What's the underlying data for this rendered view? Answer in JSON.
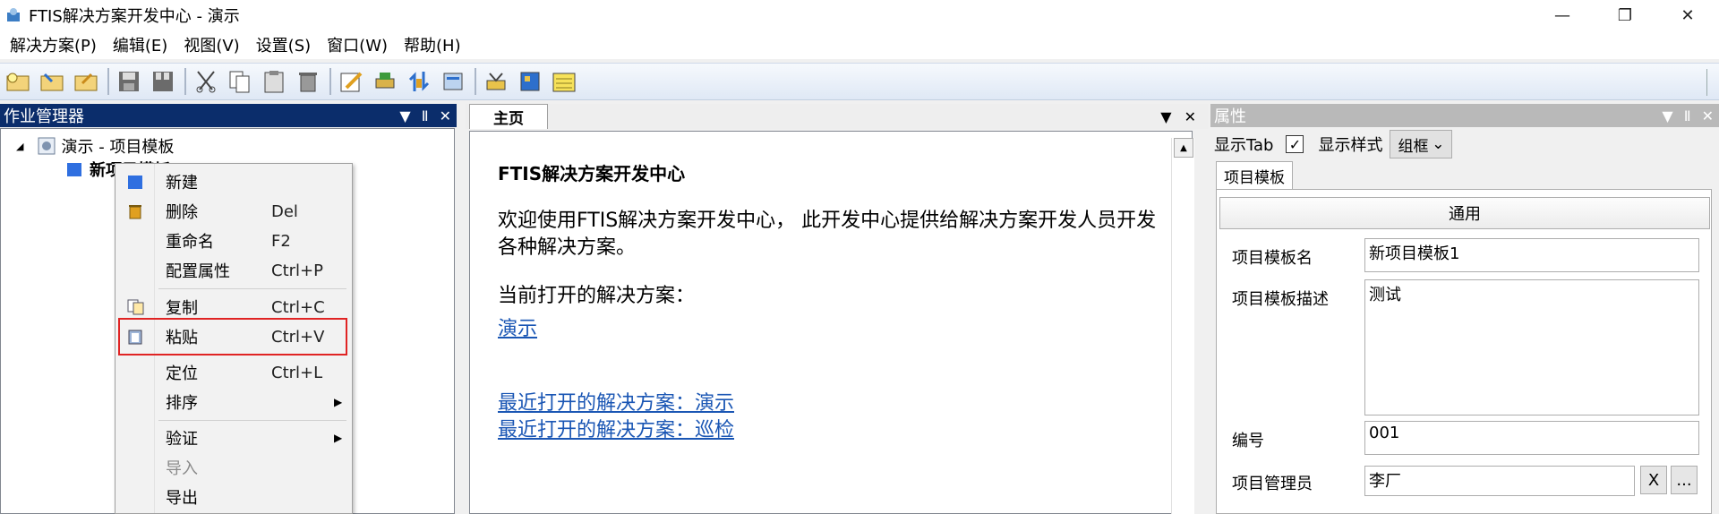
{
  "window": {
    "title": "FTIS解决方案开发中心 - 演示",
    "minimize": "—",
    "restore": "❐",
    "close": "✕"
  },
  "menu": [
    "解决方案(P)",
    "编辑(E)",
    "视图(V)",
    "设置(S)",
    "窗口(W)",
    "帮助(H)"
  ],
  "toolbar_icons": [
    "new-solution-icon",
    "open-solution-icon",
    "edit-solution-icon",
    "save-icon",
    "save-all-icon",
    "cut-icon",
    "copy-icon",
    "paste-icon",
    "delete-icon",
    "edit-icon",
    "print-icon",
    "import-icon",
    "export-icon",
    "tools-icon",
    "config-icon",
    "notes-icon"
  ],
  "left_panel": {
    "title": "作业管理器",
    "dropdown": "▼",
    "pin": "Ⅱ",
    "close": "✕",
    "tree": {
      "root_label": "演示 - 项目模板",
      "child_label": "新项目模板1"
    }
  },
  "context_menu": {
    "items": [
      {
        "label": "新建",
        "shortcut": ""
      },
      {
        "label": "删除",
        "shortcut": "Del"
      },
      {
        "label": "重命名",
        "shortcut": "F2"
      },
      {
        "label": "配置属性",
        "shortcut": "Ctrl+P"
      },
      {
        "label": "复制",
        "shortcut": "Ctrl+C"
      },
      {
        "label": "粘贴",
        "shortcut": "Ctrl+V"
      },
      {
        "label": "定位",
        "shortcut": "Ctrl+L"
      },
      {
        "label": "排序",
        "shortcut": ""
      },
      {
        "label": "验证",
        "shortcut": ""
      },
      {
        "label": "导入",
        "shortcut": ""
      },
      {
        "label": "导出",
        "shortcut": ""
      }
    ],
    "submenu_arrow": "▶"
  },
  "center": {
    "tab_label": "主页",
    "dropdown": "▼",
    "close": "✕",
    "heading": "FTIS解决方案开发中心",
    "welcome": "欢迎使用FTIS解决方案开发中心， 此开发中心提供给解决方案开发人员开发各种解决方案。",
    "current_label": "当前打开的解决方案：",
    "current_link": "演示",
    "recent_1": "最近打开的解决方案：演示",
    "recent_2": "最近打开的解决方案：巡检",
    "scroll_up": "▲"
  },
  "properties": {
    "title": "属性",
    "show_tab_label": "显示Tab",
    "show_tab_checked": "✓",
    "style_label": "显示样式",
    "style_value": "组框",
    "style_arrow": "⌄",
    "tab": "项目模板",
    "group": "通用",
    "fields": {
      "name_label": "项目模板名",
      "name_value": "新项目模板1",
      "desc_label": "项目模板描述",
      "desc_value": "测试",
      "number_label": "编号",
      "number_value": "001",
      "manager_label": "项目管理员",
      "manager_value": "李厂",
      "clear_btn": "X",
      "browse_btn": "..."
    }
  },
  "colors": {
    "active_header": "#0b2d6b",
    "inactive_header": "#b9b9b9",
    "link": "#1a56b4",
    "highlight": "#e02424"
  }
}
